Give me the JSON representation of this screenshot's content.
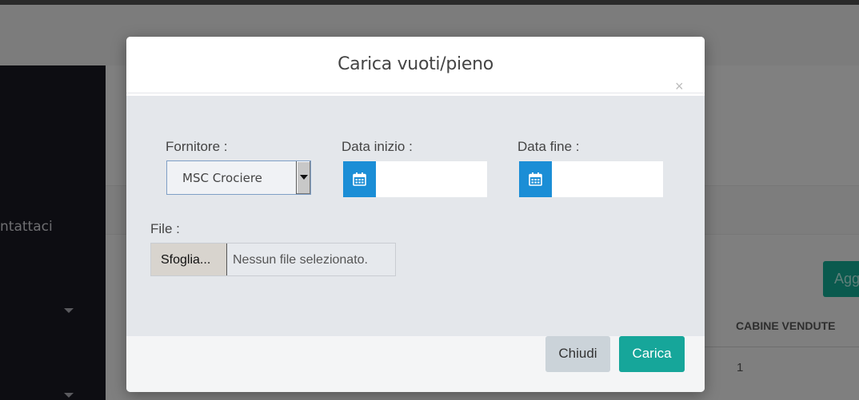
{
  "background": {
    "sidebar_item_partial": "ntattaci",
    "add_button_partial": "Agg",
    "table_header": "CABINE VENDUTE",
    "table_cell": "1"
  },
  "modal": {
    "title": "Carica vuoti/pieno",
    "close_symbol": "×",
    "fornitore_label": "Fornitore :",
    "fornitore_value": "MSC Crociere",
    "data_inizio_label": "Data inizio :",
    "data_inizio_value": "",
    "data_fine_label": "Data fine :",
    "data_fine_value": "",
    "file_label": "File :",
    "file_button_label": "Sfoglia...",
    "file_status": "Nessun file selezionato.",
    "close_button_label": "Chiudi",
    "upload_button_label": "Carica"
  },
  "icons": {
    "calendar": "calendar-icon",
    "dropdown": "chevron-down-icon",
    "close": "close-icon"
  },
  "colors": {
    "calendar_button": "#1b8ed6",
    "primary_button": "#16a69a",
    "secondary_button": "#cbd3d9",
    "overlay": "#808080"
  }
}
